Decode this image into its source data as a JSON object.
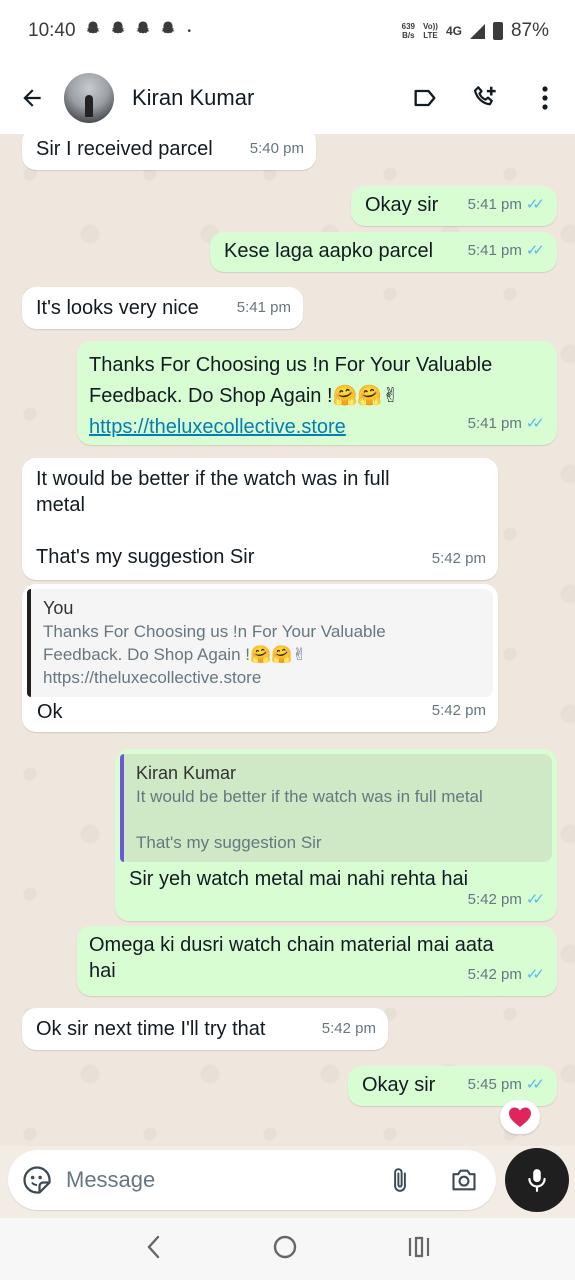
{
  "status_bar": {
    "time": "10:40",
    "notification_icons": [
      "snapchat-ghost",
      "snapchat-ghost",
      "snapchat-ghost",
      "snapchat-ghost"
    ],
    "dot": "•",
    "data_speed": "639",
    "data_unit": "B/s",
    "network_top": "Vo))",
    "network_bottom": "LTE",
    "network_type": "4G",
    "battery": "87%"
  },
  "header": {
    "contact_name": "Kiran Kumar",
    "icons": [
      "back-arrow",
      "label",
      "add-call",
      "more-vert"
    ]
  },
  "messages": [
    {
      "id": "m1",
      "dir": "in",
      "text": "Sir I received parcel",
      "time": "5:40 pm"
    },
    {
      "id": "m2",
      "dir": "out",
      "text": "Okay sir",
      "time": "5:41 pm",
      "ticks": "✓✓"
    },
    {
      "id": "m3",
      "dir": "out",
      "text": "Kese laga aapko parcel",
      "time": "5:41 pm",
      "ticks": "✓✓"
    },
    {
      "id": "m4",
      "dir": "in",
      "text": "It's looks very nice",
      "time": "5:41 pm"
    },
    {
      "id": "m5",
      "dir": "out",
      "line1": "Thanks For Choosing us !n For Your Valuable",
      "line2": "Feedback. Do Shop Again !🤗🤗✌",
      "link": "https://theluxecollective.store",
      "time": "5:41 pm",
      "ticks": "✓✓"
    },
    {
      "id": "m6",
      "dir": "in",
      "text": "It would be better if the watch was in full\nmetal\n\nThat's my suggestion Sir",
      "time": "5:42 pm"
    },
    {
      "id": "m7",
      "dir": "in",
      "quote_author": "You",
      "quote_text": "Thanks For Choosing us !n For Your Valuable\nFeedback. Do Shop Again !🤗🤗✌\nhttps://theluxecollective.store",
      "text": "Ok",
      "time": "5:42 pm"
    },
    {
      "id": "m8",
      "dir": "out",
      "quote_author": "Kiran Kumar",
      "quote_text": "It would be better if the watch was in full metal\n\nThat's my suggestion Sir",
      "text": "Sir yeh watch metal mai nahi rehta hai",
      "time": "5:42 pm",
      "ticks": "✓✓"
    },
    {
      "id": "m9",
      "dir": "out",
      "text": "Omega ki dusri watch chain material mai aata\nhai",
      "time": "5:42 pm",
      "ticks": "✓✓"
    },
    {
      "id": "m10",
      "dir": "in",
      "text": "Ok sir next time I'll try that",
      "time": "5:42 pm"
    },
    {
      "id": "m11",
      "dir": "out",
      "text": "Okay sir",
      "time": "5:45 pm",
      "ticks": "✓✓",
      "reaction": "❤️"
    }
  ],
  "input": {
    "placeholder": "Message",
    "icons": [
      "emoji-sticker",
      "attach",
      "camera",
      "mic"
    ]
  },
  "nav": {
    "icons": [
      "back",
      "home",
      "recents"
    ]
  },
  "colors": {
    "incoming_bubble": "#ffffff",
    "outgoing_bubble": "#d9fdd3",
    "read_ticks": "#53bdeb",
    "link": "#027eb5",
    "chat_background": "#efe7dd"
  }
}
